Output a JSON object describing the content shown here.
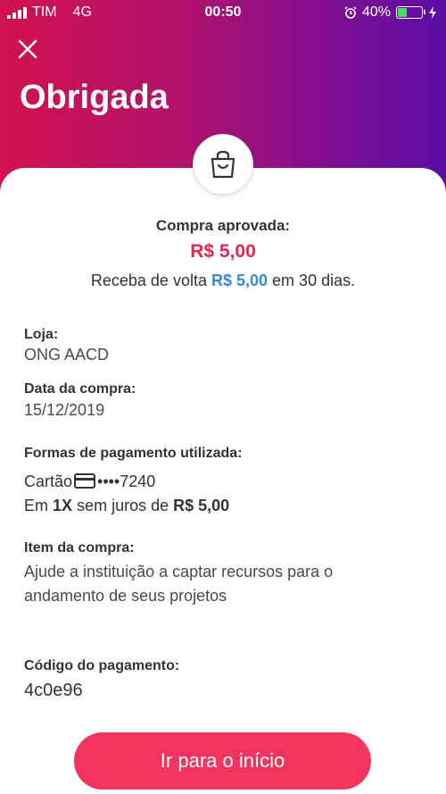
{
  "status_bar": {
    "carrier": "TIM",
    "network": "4G",
    "time": "00:50",
    "battery": "40%",
    "battery_level": 0.4
  },
  "header": {
    "title": "Obrigada"
  },
  "summary": {
    "approved_label": "Compra aprovada:",
    "amount": "R$ 5,00",
    "cashback_prefix": "Receba de volta",
    "cashback_amount": "R$ 5,00",
    "cashback_suffix": "em 30 dias."
  },
  "details": {
    "store_label": "Loja:",
    "store_value": "ONG AACD",
    "date_label": "Data da compra:",
    "date_value": "15/12/2019",
    "payment_label": "Formas de pagamento utilizada:",
    "payment_card_prefix": "Cartão",
    "payment_card_number": "••••7240",
    "installments_prefix": "Em",
    "installments_count": "1X",
    "installments_middle": "sem juros de",
    "installments_amount": "R$ 5,00",
    "item_label": "Item da compra:",
    "item_line1": "Ajude a instituição a captar recursos para o",
    "item_line2": "andamento de seus projetos",
    "code_label": "Código do pagamento:",
    "code_value": "4c0e96"
  },
  "actions": {
    "home_button": "Ir para o início"
  },
  "colors": {
    "accent": "#f2345e",
    "amount": "#e8254f",
    "cashback": "#3a86d8"
  },
  "icons": {
    "close": "close-icon",
    "bag": "shopping-bag-icon",
    "card": "credit-card-icon",
    "alarm": "alarm-icon",
    "charging": "charging-bolt-icon"
  }
}
